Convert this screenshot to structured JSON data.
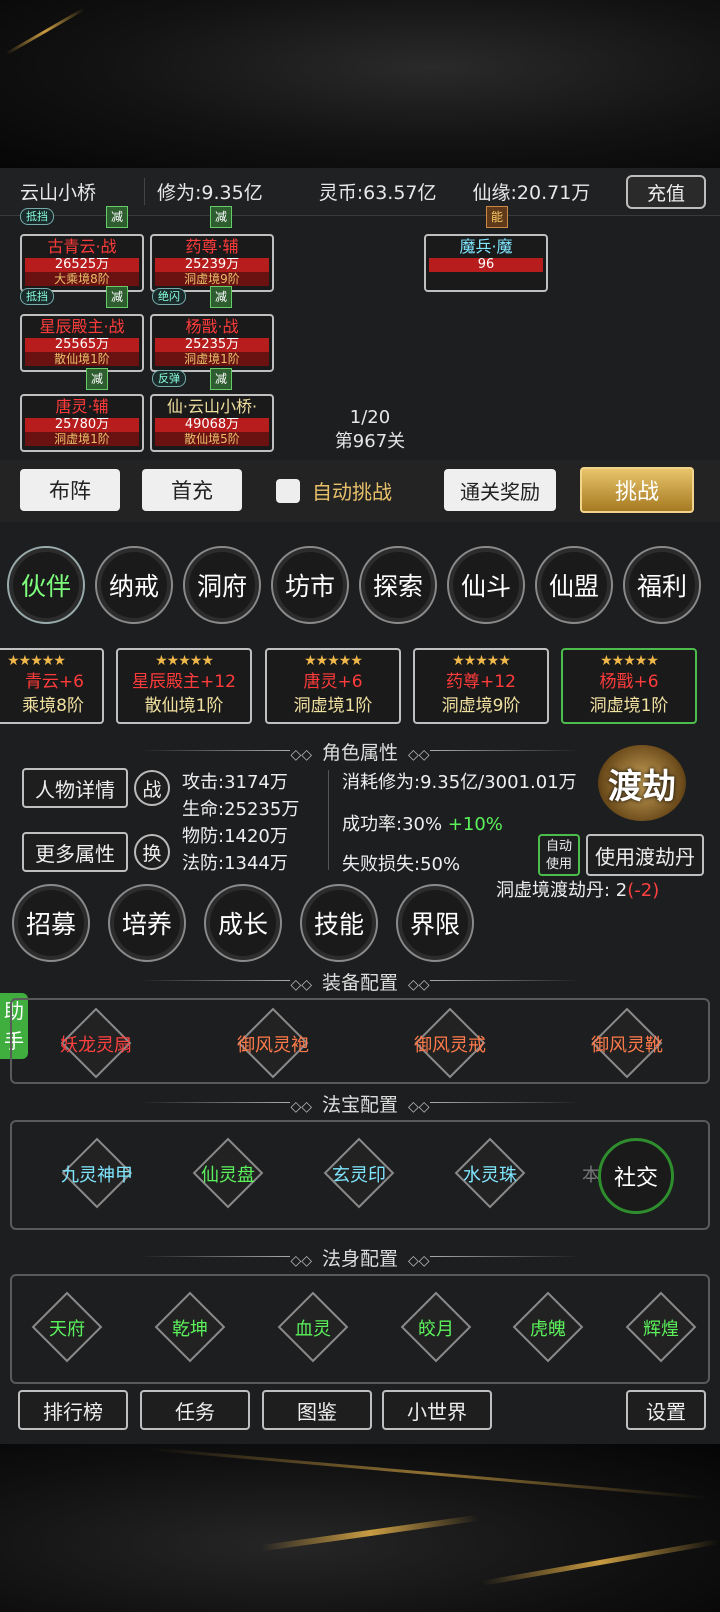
{
  "header": {
    "player_name": "云山小桥",
    "cultivation": "修为:9.35亿",
    "spirit_coin": "灵币:63.57亿",
    "xianyuan": "仙缘:20.71万",
    "recharge_label": "充值"
  },
  "battle": {
    "allies": [
      {
        "name": "古青云·战",
        "hp": "26525万",
        "realm": "大乘境8阶"
      },
      {
        "name": "药尊·辅",
        "hp": "25239万",
        "realm": "洞虚境9阶"
      },
      {
        "name": "星辰殿主·战",
        "hp": "25565万",
        "realm": "散仙境1阶"
      },
      {
        "name": "杨戬·战",
        "hp": "25235万",
        "realm": "洞虚境1阶"
      },
      {
        "name": "唐灵·辅",
        "hp": "25780万",
        "realm": "洞虚境1阶"
      },
      {
        "name": "仙·云山小桥·",
        "hp": "49068万",
        "realm": "散仙境5阶"
      }
    ],
    "enemy": {
      "name": "魔兵·魔",
      "hp": "96"
    },
    "tags": {
      "resist": "抵挡",
      "flash": "绝闪",
      "reflect": "反弹",
      "reduce": "减",
      "ability": "能"
    },
    "wave": "1/20",
    "stage": "第967关"
  },
  "actions": {
    "formation": "布阵",
    "first_recharge": "首充",
    "auto_challenge": "自动挑战",
    "clear_reward": "通关奖励",
    "challenge": "挑战"
  },
  "nav": [
    "伙伴",
    "纳戒",
    "洞府",
    "坊市",
    "探索",
    "仙斗",
    "仙盟",
    "福利"
  ],
  "partners": [
    {
      "stars": "★★★★★",
      "name": "青云+6",
      "realm": "乘境8阶"
    },
    {
      "stars": "★★★★★",
      "name": "星辰殿主+12",
      "realm": "散仙境1阶"
    },
    {
      "stars": "★★★★★",
      "name": "唐灵+6",
      "realm": "洞虚境1阶"
    },
    {
      "stars": "★★★★★",
      "name": "药尊+12",
      "realm": "洞虚境9阶"
    },
    {
      "stars": "★★★★★",
      "name": "杨戬+6",
      "realm": "洞虚境1阶"
    }
  ],
  "attributes": {
    "section_title": "角色属性",
    "detail_btn": "人物详情",
    "more_btn": "更多属性",
    "battle_icon": "战",
    "swap_icon": "换",
    "attack": "攻击:3174万",
    "hp": "生命:25235万",
    "pdef": "物防:1420万",
    "mdef": "法防:1344万",
    "consume": "消耗修为:9.35亿/3001.01万",
    "success": "成功率:30%",
    "success_bonus": "+10%",
    "fail_loss": "失败损失:50%",
    "dujie": "渡劫",
    "auto_use": "自动使用",
    "use_pill": "使用渡劫丹",
    "pill_count": "洞虚境渡劫丹: 2",
    "pill_delta": "(-2)"
  },
  "growth": [
    "招募",
    "培养",
    "成长",
    "技能",
    "界限"
  ],
  "equipment": {
    "section_title": "装备配置",
    "items": [
      "妖龙灵扇",
      "御风灵袍",
      "御风灵戒",
      "御风灵靴"
    ]
  },
  "treasure": {
    "section_title": "法宝配置",
    "items": [
      "九灵神甲",
      "仙灵盘",
      "玄灵印",
      "水灵珠",
      "本命"
    ]
  },
  "body": {
    "section_title": "法身配置",
    "items": [
      "天府",
      "乾坤",
      "血灵",
      "皎月",
      "虎魄",
      "辉煌"
    ]
  },
  "helper": "助手",
  "social": "社交",
  "bottom": {
    "ranking": "排行榜",
    "tasks": "任务",
    "codex": "图鉴",
    "small_world": "小世界",
    "settings": "设置"
  },
  "colors": {
    "accent_green": "#5bf25b",
    "name_red": "#ff3b3b",
    "gold": "#e8c06a"
  }
}
